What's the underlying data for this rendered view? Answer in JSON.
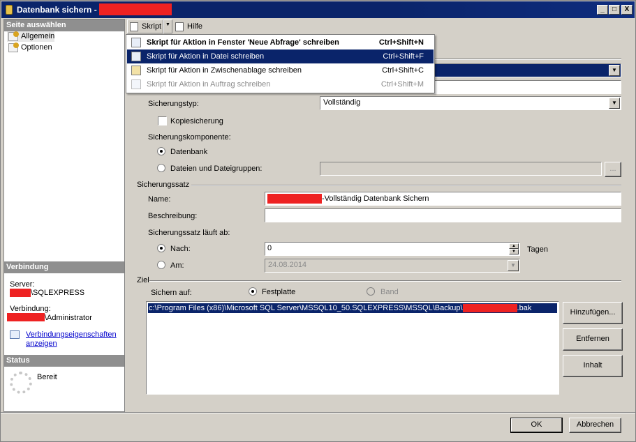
{
  "window": {
    "title": "Datenbank sichern -"
  },
  "titlebar_buttons": {
    "minimize": "_",
    "maximize": "□",
    "close": "X"
  },
  "left": {
    "select_header": "Seite auswählen",
    "pages": [
      {
        "label": "Allgemein"
      },
      {
        "label": "Optionen"
      }
    ],
    "connection_header": "Verbindung",
    "server_label": "Server:",
    "server_value": "\\SQLEXPRESS",
    "connection_label": "Verbindung:",
    "connection_value": "\\Administrator",
    "props_link_line1": "Verbindungseigenschaften",
    "props_link_line2": "anzeigen",
    "status_header": "Status",
    "status_value": "Bereit"
  },
  "toolbar": {
    "script_label": "Skript",
    "help_label": "Hilfe"
  },
  "script_menu": [
    {
      "label": "Skript für Aktion in Fenster 'Neue Abfrage' schreiben",
      "shortcut": "Ctrl+Shift+N"
    },
    {
      "label": "Skript für Aktion in Datei schreiben",
      "shortcut": "Ctrl+Shift+F"
    },
    {
      "label": "Skript für Aktion in Zwischenablage schreiben",
      "shortcut": "Ctrl+Shift+C"
    },
    {
      "label": "Skript für Aktion in Auftrag schreiben",
      "shortcut": "Ctrl+Shift+M"
    }
  ],
  "form": {
    "backup_type_label": "Sicherungstyp:",
    "backup_type_value": "Vollständig",
    "copy_backup_label": "Kopiesicherung",
    "component_label": "Sicherungskomponente:",
    "component_database": "Datenbank",
    "component_files": "Dateien und Dateigruppen:",
    "browse_label": "...",
    "backup_set_header": "Sicherungssatz",
    "name_label": "Name:",
    "name_value": "-Vollständig Datenbank Sichern",
    "description_label": "Beschreibung:",
    "description_value": "",
    "expires_label": "Sicherungssatz läuft ab:",
    "after_label": "Nach:",
    "after_value": "0",
    "days_label": "Tagen",
    "on_label": "Am:",
    "on_value": "24.08.2014",
    "destination_header": "Ziel",
    "backup_to_label": "Sichern auf:",
    "disk_label": "Festplatte",
    "tape_label": "Band",
    "destinations": [
      {
        "path": "c:\\Program Files (x86)\\Microsoft SQL Server\\MSSQL10_50.SQLEXPRESS\\MSSQL\\Backup\\",
        "ext": ".bak"
      }
    ],
    "add_button": "Hinzufügen...",
    "remove_button": "Entfernen",
    "contents_button": "Inhalt"
  },
  "footer": {
    "ok_button": "OK",
    "cancel_button": "Abbrechen"
  },
  "colors": {
    "titlebar": "#0a246a",
    "redaction": "#ee2222",
    "selection": "#0a246a"
  }
}
